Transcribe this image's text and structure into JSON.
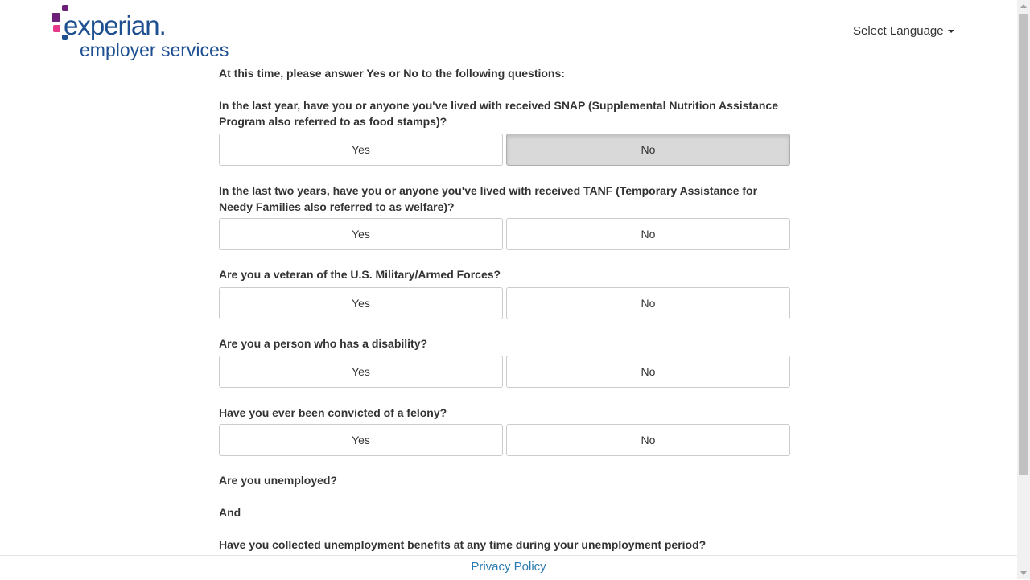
{
  "header": {
    "logo_text_primary": "experian.",
    "logo_text_secondary": "employer services",
    "language_selector": "Select Language",
    "brand_colors": {
      "navy": "#1d4f91",
      "purple": "#6d2077",
      "magenta": "#e63888"
    }
  },
  "intro": "At this time, please answer Yes or No to the following questions:",
  "questions": [
    {
      "text": "In the last year, have you or anyone you've lived with received SNAP (Supplemental Nutrition Assistance Program also referred to as food stamps)?",
      "yes": "Yes",
      "no": "No",
      "selected": "No"
    },
    {
      "text": "In the last two years, have you or anyone you've lived with received TANF (Temporary Assistance for Needy Families also referred to as welfare)?",
      "yes": "Yes",
      "no": "No",
      "selected": ""
    },
    {
      "text": "Are you a veteran of the U.S. Military/Armed Forces?",
      "yes": "Yes",
      "no": "No",
      "selected": ""
    },
    {
      "text": "Are you a person who has a disability?",
      "yes": "Yes",
      "no": "No",
      "selected": ""
    },
    {
      "text": "Have you ever been convicted of a felony?",
      "yes": "Yes",
      "no": "No",
      "selected": ""
    }
  ],
  "unemployment": {
    "q1": "Are you unemployed?",
    "connector": "And",
    "q2": "Have you collected unemployment benefits at any time during your unemployment period?"
  },
  "footer": {
    "privacy_link": "Privacy Policy"
  }
}
